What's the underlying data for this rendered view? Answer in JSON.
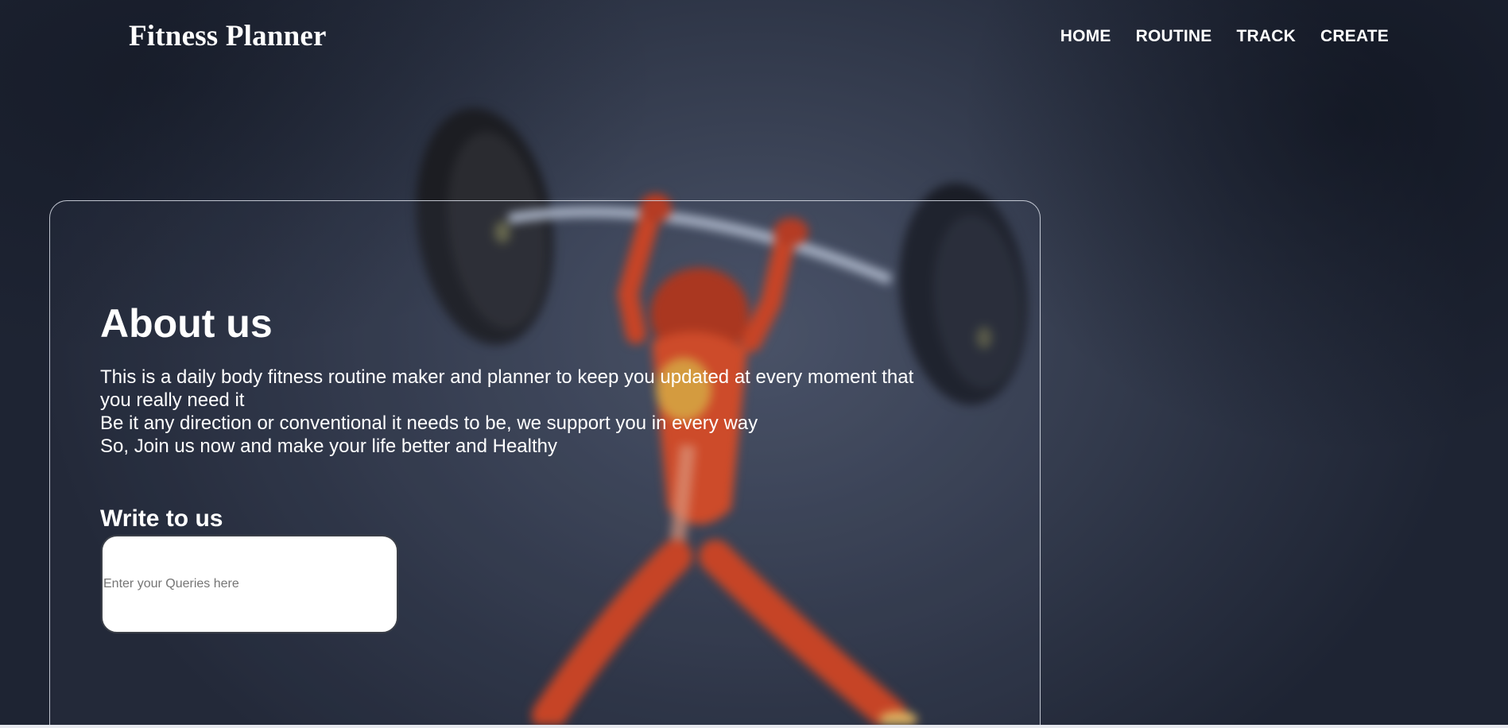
{
  "header": {
    "logo": "Fitness Planner",
    "nav": [
      {
        "label": "HOME"
      },
      {
        "label": "ROUTINE"
      },
      {
        "label": "TRACK"
      },
      {
        "label": "CREATE"
      }
    ]
  },
  "about": {
    "title": "About us",
    "lines": [
      "This is a daily body fitness routine maker and planner to keep you updated at every moment that you really need it",
      "Be it any direction or conventional it needs to be, we support you in every way",
      "So, Join us now and make your life better and Healthy"
    ]
  },
  "contact": {
    "title": "Write to us",
    "query_placeholder": "Enter your Queries here",
    "query_value": ""
  },
  "colors": {
    "background": "#2f3647",
    "figure": "#e0461f",
    "text": "#ffffff",
    "card_border": "#dce1eb"
  }
}
